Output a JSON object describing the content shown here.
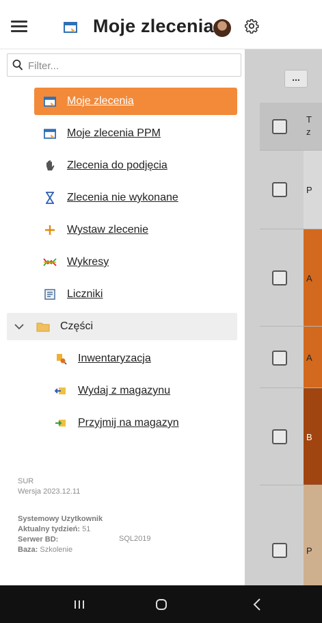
{
  "header": {
    "title": "Moje zlecenia",
    "menu_icon": "hamburger-icon",
    "title_icon": "window-icon",
    "settings_icon": "gear-icon"
  },
  "filter": {
    "placeholder": "Filter..."
  },
  "menu": {
    "items": [
      {
        "label": "Moje zlecenia",
        "icon": "window-icon",
        "active": true
      },
      {
        "label": "Moje zlecenia PPM",
        "icon": "window-icon"
      },
      {
        "label": "Zlecenia do podjęcia",
        "icon": "hand-icon"
      },
      {
        "label": "Zlecenia nie wykonane",
        "icon": "hourglass-icon"
      },
      {
        "label": "Wystaw zlecenie",
        "icon": "plus-icon"
      },
      {
        "label": "Wykresy",
        "icon": "chart-icon"
      },
      {
        "label": "Liczniki",
        "icon": "counter-icon"
      }
    ],
    "group": {
      "label": "Części",
      "icon": "folder-icon",
      "expanded": true,
      "children": [
        {
          "label": "Inwentaryzacja",
          "icon": "inventory-icon"
        },
        {
          "label": "Wydaj z magazynu",
          "icon": "stock-out-icon"
        },
        {
          "label": "Przyjmij na magazyn",
          "icon": "stock-in-icon"
        }
      ]
    }
  },
  "footer": {
    "app": "SUR",
    "version": "Wersja 2023.12.11",
    "user": "Systemowy Uzytkownik",
    "week_label": "Aktualny tydzień:",
    "week_value": "51",
    "server_label": "Serwer BD:",
    "server_value": "SQL2019",
    "base_label": "Baza:",
    "base_value": "Szkolenie"
  },
  "background": {
    "more_label": "...",
    "header_cell": "T\nz",
    "rows": [
      {
        "cell": "P",
        "color": "#d9d9d9"
      },
      {
        "cell": "A",
        "color": "#d2691e"
      },
      {
        "cell": "A",
        "color": "#d2691e"
      },
      {
        "cell": "B",
        "color": "#a0450f"
      },
      {
        "cell": "P",
        "color": "#cfb08e"
      }
    ]
  },
  "colors": {
    "accent": "#f28a3a",
    "overlay": "#cfcfcf"
  }
}
